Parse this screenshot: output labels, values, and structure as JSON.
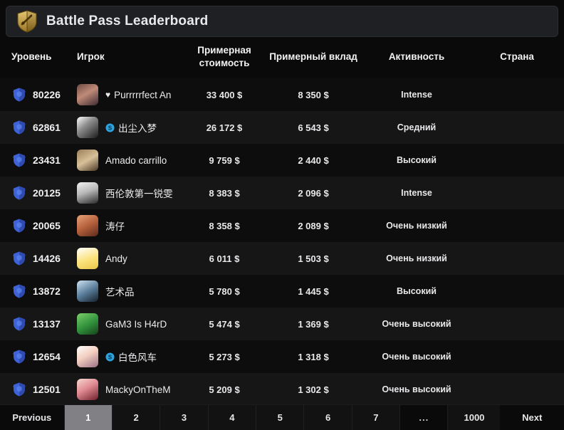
{
  "window": {
    "title": "Battle Pass Leaderboard",
    "icon": "battlepass-shield-icon",
    "accent_color": "#c9a227",
    "background_color": "#0a0a0a",
    "titlebar_color": "#1f2023"
  },
  "table": {
    "columns": [
      {
        "key": "level",
        "label": "Уровень"
      },
      {
        "key": "player",
        "label": "Игрок"
      },
      {
        "key": "value",
        "label": "Примерная стоимость"
      },
      {
        "key": "contrib",
        "label": "Примерный вклад"
      },
      {
        "key": "act",
        "label": "Активность"
      },
      {
        "key": "country",
        "label": "Страна"
      }
    ],
    "rows": [
      {
        "level": "80226",
        "player": "Purrrrrfect An",
        "prefix_icon": "heart-icon",
        "value": "33 400 $",
        "contrib": "8 350 $",
        "act": "Intense",
        "country": ""
      },
      {
        "level": "62861",
        "player": "出尘入梦",
        "prefix_icon": "blue-badge-icon",
        "value": "26 172 $",
        "contrib": "6 543 $",
        "act": "Средний",
        "country": ""
      },
      {
        "level": "23431",
        "player": "Amado carrillo",
        "prefix_icon": "",
        "value": "9 759 $",
        "contrib": "2 440 $",
        "act": "Высокий",
        "country": ""
      },
      {
        "level": "20125",
        "player": "西伦敦第一锐雯",
        "prefix_icon": "",
        "value": "8 383 $",
        "contrib": "2 096 $",
        "act": "Intense",
        "country": ""
      },
      {
        "level": "20065",
        "player": "涛仔",
        "prefix_icon": "",
        "value": "8 358 $",
        "contrib": "2 089 $",
        "act": "Очень низкий",
        "country": ""
      },
      {
        "level": "14426",
        "player": "Andy",
        "prefix_icon": "",
        "value": "6 011 $",
        "contrib": "1 503 $",
        "act": "Очень низкий",
        "country": ""
      },
      {
        "level": "13872",
        "player": "艺术品",
        "prefix_icon": "",
        "value": "5 780 $",
        "contrib": "1 445 $",
        "act": "Высокий",
        "country": ""
      },
      {
        "level": "13137",
        "player": "GaM3 Is H4rD",
        "prefix_icon": "",
        "value": "5 474 $",
        "contrib": "1 369 $",
        "act": "Очень высокий",
        "country": ""
      },
      {
        "level": "12654",
        "player": "白色风车",
        "prefix_icon": "blue-badge-icon",
        "value": "5 273 $",
        "contrib": "1 318 $",
        "act": "Очень высокий",
        "country": ""
      },
      {
        "level": "12501",
        "player": "MackyOnTheM",
        "prefix_icon": "",
        "value": "5 209 $",
        "contrib": "1 302 $",
        "act": "Очень высокий",
        "country": ""
      }
    ]
  },
  "pagination": {
    "previous_label": "Previous",
    "next_label": "Next",
    "pages": [
      "1",
      "2",
      "3",
      "4",
      "5",
      "6",
      "7",
      "...",
      "1000"
    ],
    "active_page": "1",
    "active_bg": "#818185"
  }
}
